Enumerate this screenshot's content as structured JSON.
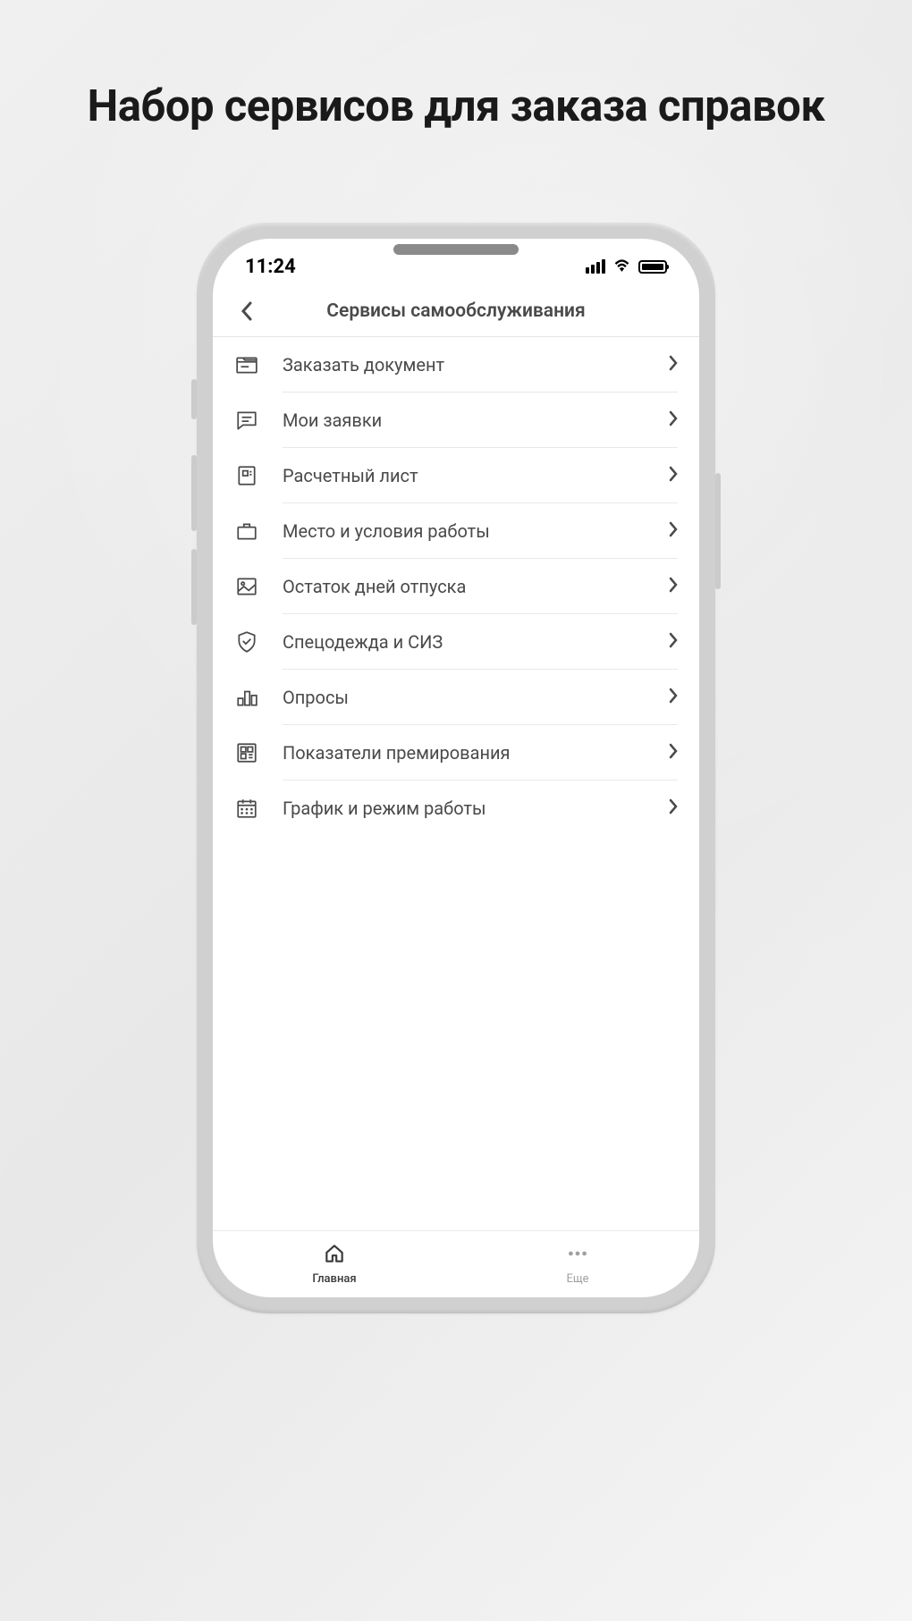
{
  "marketing": {
    "title": "Набор сервисов для заказа справок"
  },
  "statusBar": {
    "time": "11:24"
  },
  "header": {
    "title": "Сервисы самообслуживания"
  },
  "menu": {
    "items": [
      {
        "label": "Заказать документ",
        "icon": "folder"
      },
      {
        "label": "Мои заявки",
        "icon": "chat"
      },
      {
        "label": "Расчетный лист",
        "icon": "receipt"
      },
      {
        "label": "Место и условия работы",
        "icon": "briefcase"
      },
      {
        "label": "Остаток дней отпуска",
        "icon": "image"
      },
      {
        "label": "Спецодежда и СИЗ",
        "icon": "shield"
      },
      {
        "label": "Опросы",
        "icon": "chart"
      },
      {
        "label": "Показатели премирования",
        "icon": "qr"
      },
      {
        "label": "График и режим работы",
        "icon": "calendar"
      }
    ]
  },
  "bottomNav": {
    "tabs": [
      {
        "label": "Главная",
        "icon": "home",
        "active": true
      },
      {
        "label": "Еще",
        "icon": "dots",
        "active": false
      }
    ]
  }
}
